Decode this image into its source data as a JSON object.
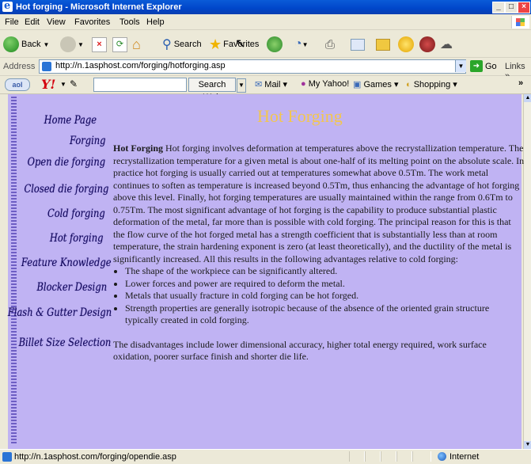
{
  "window": {
    "title": "Hot forging - Microsoft Internet Explorer"
  },
  "menu": [
    "File",
    "Edit",
    "View",
    "Favorites",
    "Tools",
    "Help"
  ],
  "toolbar": {
    "back": "Back",
    "search": "Search",
    "favorites": "Favorites"
  },
  "address": {
    "label": "Address",
    "url": "http://n.1asphost.com/forging/hotforging.asp",
    "go": "Go",
    "links": "Links"
  },
  "yahoo": {
    "search_button": "Search Web",
    "mail": "Mail",
    "my_yahoo": "My Yahoo!",
    "games": "Games",
    "shopping": "Shopping"
  },
  "nav": [
    "Home Page",
    "Forging",
    "Open die forging",
    "Closed die forging",
    "Cold forging",
    "Hot forging",
    "Feature Knowledge",
    "Blocker Design",
    "Flash & Gutter Design",
    "Billet Size Selection"
  ],
  "page": {
    "title": "Hot Forging",
    "lead_bold": "Hot Forging",
    "intro": " Hot forging involves deformation at temperatures above the recrystallization temperature. The recrystallization temperature for a given metal is about one-half of its melting point on the absolute scale. In practice hot forging is usually carried out at temperatures somewhat above 0.5Tm. The work metal continues to soften as temperature is increased beyond 0.5Tm, thus enhancing the advantage of hot forging above this level. Finally, hot forging temperatures are usually maintained within the range from 0.6Tm to 0.75Tm. The most significant advantage of hot forging is the capability to produce substantial plastic deformation of the metal, far more than is possible with cold forging. The principal reason for this is that the flow curve of the hot forged metal has a strength coefficient that is substantially less than at room temperature, the strain hardening exponent is zero (at least theoretically), and the ductility of the metal is significantly increased. All this results in the following advantages relative to cold forging:",
    "advantages": [
      "The shape of the workpiece can be significantly altered.",
      "Lower forces and power are required to deform the metal.",
      "Metals that usually fracture in cold forging can be hot forged.",
      "Strength properties are generally isotropic because of the absence of the oriented grain structure typically created in cold forging."
    ],
    "disadvantages": "The disadvantages include lower dimensional accuracy, higher total energy required, work surface oxidation, poorer surface finish and shorter die life."
  },
  "status": {
    "text": "http://n.1asphost.com/forging/opendie.asp",
    "zone": "Internet"
  }
}
